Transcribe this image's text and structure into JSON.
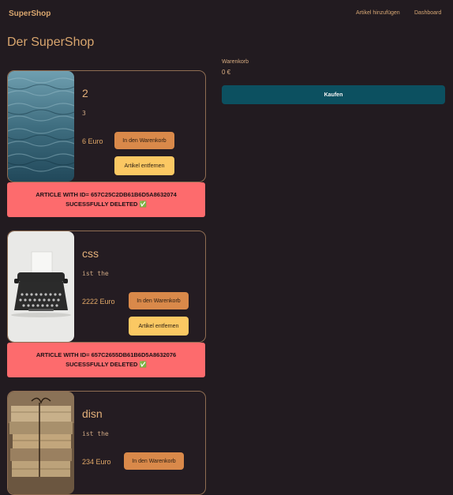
{
  "nav": {
    "brand": "SuperShop",
    "add_article": "Artikel hinzufügen",
    "dashboard": "Dashboard"
  },
  "page": {
    "title": "Der SuperShop"
  },
  "products": [
    {
      "title": "2",
      "description": "3",
      "price": "6 Euro",
      "cart_button": "In den Warenkorb",
      "remove_button": "Artikel entfernen",
      "image": "ocean-water-image"
    },
    {
      "title": "css",
      "description": "ist the",
      "price": "2222 Euro",
      "cart_button": "In den Warenkorb",
      "remove_button": "Artikel entfernen",
      "image": "typewriter-image"
    },
    {
      "title": "disn",
      "description": "ist the",
      "price": "234 Euro",
      "cart_button": "In den Warenkorb",
      "image": "old-books-image"
    }
  ],
  "alerts": [
    {
      "text": "ARTICLE WITH ID= 657C25C2DB61B6D5A8632074 SUCESSFULLY DELETED ✅"
    },
    {
      "text": "ARTICLE WITH ID= 657C2655DB61B6D5A8632076 SUCESSFULLY DELETED ✅"
    }
  ],
  "cart": {
    "label": "Warenkorb",
    "total": "0 €",
    "buy_button": "Kaufen"
  },
  "colors": {
    "background": "#221b20",
    "accent": "#d9a66e",
    "cart_button": "#d9894a",
    "remove_button": "#fbc863",
    "alert": "#fd6b6d",
    "buy_button": "#0c5060"
  }
}
